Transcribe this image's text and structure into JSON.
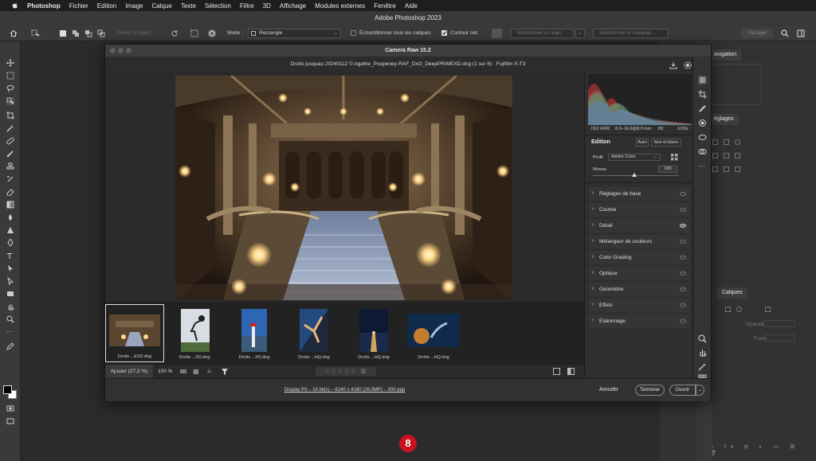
{
  "menubar": {
    "app": "Photoshop",
    "items": [
      "Fichier",
      "Edition",
      "Image",
      "Calque",
      "Texte",
      "Sélection",
      "Filtre",
      "3D",
      "Affichage",
      "Modules externes",
      "Fenêtre",
      "Aide"
    ]
  },
  "ps_title": "Adobe Photoshop 2023",
  "options": {
    "finder": "Finder d'objets",
    "mode_label": "Mode :",
    "mode_value": "Rectangle",
    "sample_all": "Échantillonner tous les calques",
    "sample_all_checked": false,
    "contour_net": "Contour net",
    "contour_net_checked": true,
    "select_subject": "Sélectionner un sujet",
    "select_mask": "Sélectionner et masquer...",
    "share": "Partager"
  },
  "right_panels": {
    "navigation_tab": "avigation",
    "reglages_tab": "églages",
    "calques_tab": "Calques",
    "opacite": "Opacité :",
    "fond": "Fond :"
  },
  "camera_raw": {
    "title": "Camera Raw 15.2",
    "file_info": "Droits jusquau 20240112 © Agathe_Poupeney-RAF_DxO_DeepPRIMEXD.dng (1 sur 6)   ·   Fujifilm X-T3",
    "exif": {
      "iso": "ISO 6400",
      "focal": "8.0–16.0@8.0 mm",
      "aperture": "f/8",
      "shutter": "1/30s"
    },
    "edit_label": "Edition",
    "auto_button": "Auto",
    "bw_button": "Noir et blanc",
    "profile_label": "Profil",
    "profile_value": "Adobe Color",
    "level_label": "Niveau",
    "level_value": "100",
    "sections": [
      "Réglages de base",
      "Courbe",
      "Détail",
      "Mélangeur de couleurs",
      "Color Grading",
      "Optique",
      "Géométrie",
      "Effets",
      "Etalonnage"
    ],
    "thumbs": [
      "Droits ...EXD.dng",
      "Droits ...XD.dng",
      "Droits ...XD.dng",
      "Droits ...HQ.dng",
      "Droits ...HQ.dng",
      "Droits ...HQ.dng"
    ],
    "fit": "Ajuster (27,2 %)",
    "zoom": "100 %",
    "workflow": "Display P3 – 16 bit(s) – 6240 x 4160 (26,0MP) – 300 ppp",
    "cancel": "Annuler",
    "done": "Terminer",
    "open": "Ouvrir"
  },
  "step_badge": "8",
  "colors": {
    "accent_red": "#c8141e",
    "panel_bg": "#2c2c2c"
  }
}
